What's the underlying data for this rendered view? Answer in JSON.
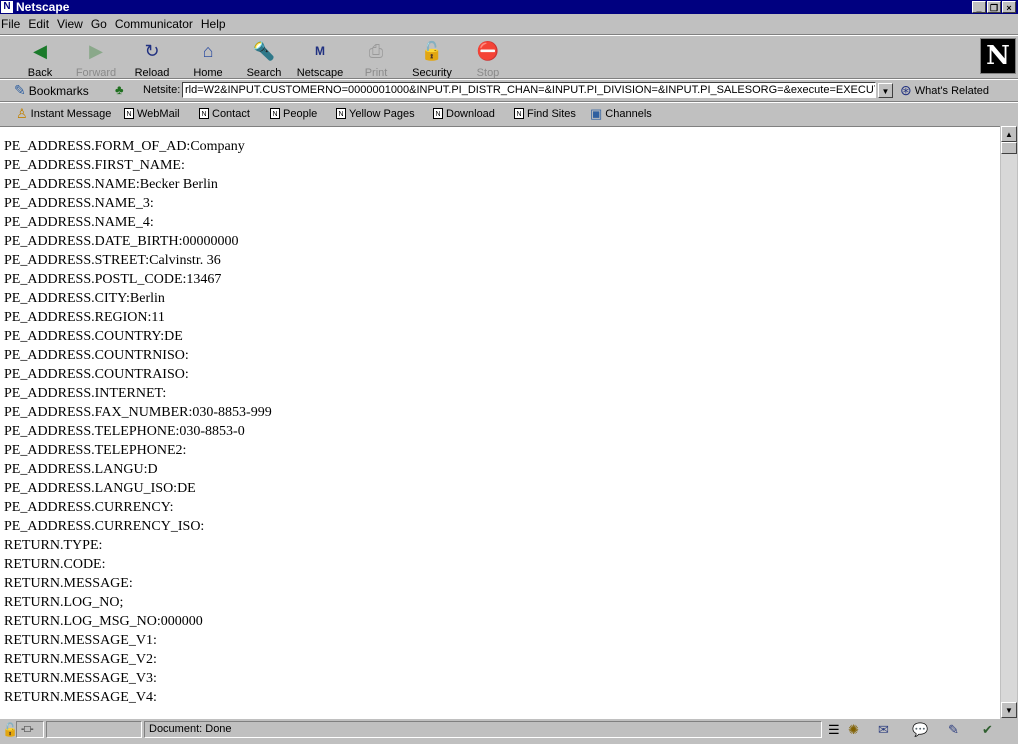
{
  "window": {
    "title": "Netscape"
  },
  "menu": [
    "File",
    "Edit",
    "View",
    "Go",
    "Communicator",
    "Help"
  ],
  "toolbar": {
    "buttons": [
      {
        "label": "Back",
        "icon": "back-arrow-icon"
      },
      {
        "label": "Forward",
        "icon": "forward-arrow-icon"
      },
      {
        "label": "Reload",
        "icon": "reload-icon"
      },
      {
        "label": "Home",
        "icon": "home-icon"
      },
      {
        "label": "Search",
        "icon": "search-icon"
      },
      {
        "label": "Netscape",
        "icon": "netscape-icon"
      },
      {
        "label": "Print",
        "icon": "printer-icon"
      },
      {
        "label": "Security",
        "icon": "lock-icon"
      },
      {
        "label": "Stop",
        "icon": "stop-icon"
      }
    ]
  },
  "location": {
    "bookmarks_label": "Bookmarks",
    "netsite_label": "Netsite:",
    "url": "rld=W2&INPUT.CUSTOMERNO=0000001000&INPUT.PI_DISTR_CHAN=&INPUT.PI_DIVISION=&INPUT.PI_SALESORG=&execute=EXECUTE",
    "related_label": "What's Related"
  },
  "personal": [
    "Instant Message",
    "WebMail",
    "Contact",
    "People",
    "Yellow Pages",
    "Download",
    "Find Sites",
    "Channels"
  ],
  "content": {
    "lines": [
      "PE_ADDRESS.FORM_OF_AD:Company",
      "PE_ADDRESS.FIRST_NAME:",
      "PE_ADDRESS.NAME:Becker Berlin",
      "PE_ADDRESS.NAME_3:",
      "PE_ADDRESS.NAME_4:",
      "PE_ADDRESS.DATE_BIRTH:00000000",
      "PE_ADDRESS.STREET:Calvinstr. 36",
      "PE_ADDRESS.POSTL_CODE:13467",
      "PE_ADDRESS.CITY:Berlin",
      "PE_ADDRESS.REGION:11",
      "PE_ADDRESS.COUNTRY:DE",
      "PE_ADDRESS.COUNTRNISO:",
      "PE_ADDRESS.COUNTRAISO:",
      "PE_ADDRESS.INTERNET:",
      "PE_ADDRESS.FAX_NUMBER:030-8853-999",
      "PE_ADDRESS.TELEPHONE:030-8853-0",
      "PE_ADDRESS.TELEPHONE2:",
      "PE_ADDRESS.LANGU:D",
      "PE_ADDRESS.LANGU_ISO:DE",
      "PE_ADDRESS.CURRENCY:",
      "PE_ADDRESS.CURRENCY_ISO:",
      "RETURN.TYPE:",
      "RETURN.CODE:",
      "RETURN.MESSAGE:",
      "RETURN.LOG_NO;",
      "RETURN.LOG_MSG_NO:000000",
      "RETURN.MESSAGE_V1:",
      "RETURN.MESSAGE_V2:",
      "RETURN.MESSAGE_V3:",
      "RETURN.MESSAGE_V4:"
    ]
  },
  "status": {
    "text": "Document: Done"
  }
}
